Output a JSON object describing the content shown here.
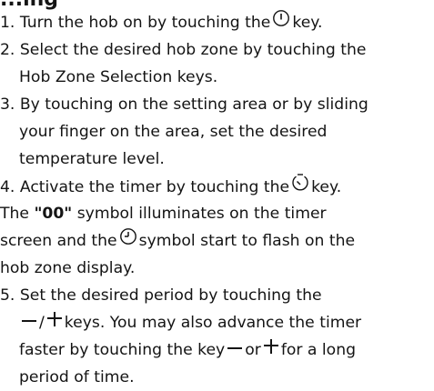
{
  "heading": "...ing",
  "steps": {
    "s1": {
      "num": "1. ",
      "pre": "Turn the hob on by touching the",
      "post": "key.",
      "icon": "power-icon"
    },
    "s2": {
      "num": "2. ",
      "l1": "Select the desired hob zone by touching the",
      "l2": "Hob Zone Selection keys."
    },
    "s3": {
      "num": "3. ",
      "l1": "By touching on the setting area or by sliding",
      "l2": "your finger on the area, set the desired",
      "l3": "temperature level."
    },
    "s4": {
      "num": "4. ",
      "pre": "Activate the timer by touching the",
      "post": "key.",
      "icon": "timer-icon"
    },
    "note": {
      "pre": "The ",
      "code": "\"00\"",
      "post": " symbol illuminates on the timer",
      "l2": "screen and the",
      "l2_post": "symbol start to flash on the",
      "l3": "hob zone display.",
      "icon": "clock-icon"
    },
    "s5": {
      "num": "5. ",
      "l1": "Set the desired period by touching the",
      "l2_post": "keys. You may also advance the timer",
      "l3_pre": "faster by touching the key",
      "l3_mid": "or",
      "l3_post": "for a long",
      "l4": "period of time."
    }
  }
}
